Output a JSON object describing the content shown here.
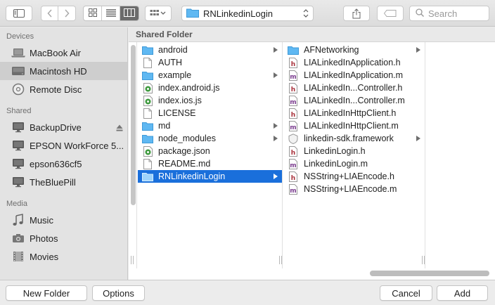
{
  "toolbar": {
    "path_folder": "RNLinkedinLogin",
    "search_placeholder": "Search"
  },
  "sidebar": {
    "sections": [
      {
        "title": "Devices"
      },
      {
        "title": "Shared"
      },
      {
        "title": "Media"
      }
    ],
    "devices": [
      {
        "label": "MacBook Air",
        "icon": "laptop-icon"
      },
      {
        "label": "Macintosh HD",
        "icon": "hard-drive-icon",
        "selected": true
      },
      {
        "label": "Remote Disc",
        "icon": "disc-icon"
      }
    ],
    "shared": [
      {
        "label": "BackupDrive",
        "icon": "monitor-icon",
        "eject": true
      },
      {
        "label": "EPSON WorkForce 5...",
        "icon": "monitor-icon"
      },
      {
        "label": "epson636cf5",
        "icon": "monitor-icon"
      },
      {
        "label": "TheBluePill",
        "icon": "monitor-icon"
      }
    ],
    "media": [
      {
        "label": "Music",
        "icon": "music-note-icon"
      },
      {
        "label": "Photos",
        "icon": "camera-icon"
      },
      {
        "label": "Movies",
        "icon": "film-icon"
      }
    ]
  },
  "browser": {
    "header": "Shared Folder",
    "column1": [
      {
        "name": "android",
        "type": "folder",
        "arrow": true
      },
      {
        "name": "AUTH",
        "type": "file"
      },
      {
        "name": "example",
        "type": "folder",
        "arrow": true
      },
      {
        "name": "index.android.js",
        "type": "js"
      },
      {
        "name": "index.ios.js",
        "type": "js"
      },
      {
        "name": "LICENSE",
        "type": "file"
      },
      {
        "name": "md",
        "type": "folder",
        "arrow": true
      },
      {
        "name": "node_modules",
        "type": "folder",
        "arrow": true
      },
      {
        "name": "package.json",
        "type": "js"
      },
      {
        "name": "README.md",
        "type": "file"
      },
      {
        "name": "RNLinkedinLogin",
        "type": "folder",
        "arrow": true,
        "selected": true
      }
    ],
    "column2": [
      {
        "name": "AFNetworking",
        "type": "folder",
        "arrow": true
      },
      {
        "name": "LIALinkedInApplication.h",
        "type": "h"
      },
      {
        "name": "LIALinkedInApplication.m",
        "type": "m"
      },
      {
        "name": "LIALinkedIn...Controller.h",
        "type": "h"
      },
      {
        "name": "LIALinkedIn...Controller.m",
        "type": "m"
      },
      {
        "name": "LIALinkedInHttpClient.h",
        "type": "h"
      },
      {
        "name": "LIALinkedInHttpClient.m",
        "type": "m"
      },
      {
        "name": "linkedin-sdk.framework",
        "type": "framework",
        "arrow": true
      },
      {
        "name": "LinkedinLogin.h",
        "type": "h"
      },
      {
        "name": "LinkedinLogin.m",
        "type": "m"
      },
      {
        "name": "NSString+LIAEncode.h",
        "type": "h"
      },
      {
        "name": "NSString+LIAEncode.m",
        "type": "m"
      }
    ]
  },
  "bottom": {
    "new_folder": "New Folder",
    "options": "Options",
    "cancel": "Cancel",
    "add": "Add"
  },
  "colors": {
    "selection": "#1a6fdb",
    "folder": "#5fb8f2",
    "h_file": "#a8303a",
    "m_file": "#7b3d8f",
    "js_file": "#3f9a3f"
  }
}
